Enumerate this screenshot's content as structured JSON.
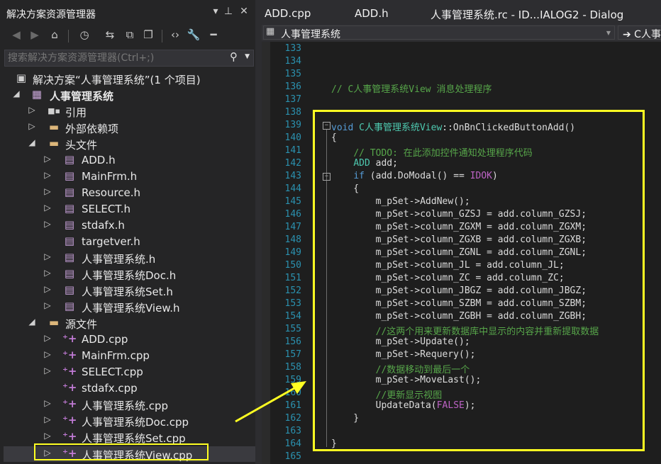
{
  "solution_explorer": {
    "title": "解决方案资源管理器",
    "search_placeholder": "搜索解决方案资源管理器(Ctrl+;)",
    "solution_label": "解决方案“人事管理系统”(1 个项目)",
    "project_label": "人事管理系统",
    "references_label": "引用",
    "external_deps_label": "外部依赖项",
    "header_folder_label": "头文件",
    "header_files": [
      "ADD.h",
      "MainFrm.h",
      "Resource.h",
      "SELECT.h",
      "stdafx.h",
      "targetver.h",
      "人事管理系统.h",
      "人事管理系统Doc.h",
      "人事管理系统Set.h",
      "人事管理系统View.h"
    ],
    "source_folder_label": "源文件",
    "source_files": [
      "ADD.cpp",
      "MainFrm.cpp",
      "SELECT.cpp",
      "stdafx.cpp",
      "人事管理系统.cpp",
      "人事管理系统Doc.cpp",
      "人事管理系统Set.cpp",
      "人事管理系统View.cpp"
    ]
  },
  "editor_tabs": [
    "ADD.cpp",
    "ADD.h",
    "人事管理系统.rc - ID...IALOG2 - Dialog"
  ],
  "nav_bar": {
    "project_combo": "人事管理系统",
    "scope_combo": "➔ C人事"
  },
  "code": {
    "line_numbers": [
      "133",
      "134",
      "135",
      "136",
      "137",
      "138",
      "139",
      "140",
      "141",
      "142",
      "143",
      "144",
      "145",
      "146",
      "147",
      "148",
      "149",
      "150",
      "151",
      "152",
      "153",
      "154",
      "155",
      "156",
      "157",
      "158",
      "159",
      "160",
      "161",
      "162",
      "163",
      "164",
      "165"
    ],
    "lines": [
      "",
      "",
      "",
      "// C人事管理系统View 消息处理程序",
      "",
      "",
      "void C人事管理系统View::OnBnClickedButtonAdd()",
      "{",
      "    // TODO: 在此添加控件通知处理程序代码",
      "    ADD add;",
      "    if (add.DoModal() == IDOK)",
      "    {",
      "        m_pSet->AddNew();",
      "        m_pSet->column_GZSJ = add.column_GZSJ;",
      "        m_pSet->column_ZGXM = add.column_ZGXM;",
      "        m_pSet->column_ZGXB = add.column_ZGXB;",
      "        m_pSet->column_ZGNL = add.column_ZGNL;",
      "        m_pSet->column_JL = add.column_JL;",
      "        m_pSet->column_ZC = add.column_ZC;",
      "        m_pSet->column_JBGZ = add.column_JBGZ;",
      "        m_pSet->column_SZBM = add.column_SZBM;",
      "        m_pSet->column_ZGBH = add.column_ZGBH;",
      "        //这两个用来更新数据库中显示的内容并重新提取数据",
      "        m_pSet->Update();",
      "        m_pSet->Requery();",
      "        //数据移动到最后一个",
      "        m_pSet->MoveLast();",
      "        //更新显示视图",
      "        UpdateData(FALSE);",
      "    }",
      "",
      "}",
      ""
    ]
  },
  "colors": {
    "comment": "#57a64a",
    "keyword": "#569cd6",
    "type": "#4ec9b0",
    "macro": "#bd63c5",
    "line_number": "#2b91af",
    "annotation": "#ffff22"
  },
  "icons": [
    "dock-dropdown-icon",
    "pin-icon",
    "close-icon",
    "back-icon",
    "forward-icon",
    "home-icon",
    "history-icon",
    "sync-icon",
    "collapse-icon",
    "show-all-icon",
    "view-code-icon",
    "properties-icon",
    "preview-icon",
    "search-icon",
    "solution-icon",
    "project-icon",
    "references-icon",
    "folder-icon",
    "header-file-icon",
    "cpp-file-icon"
  ]
}
